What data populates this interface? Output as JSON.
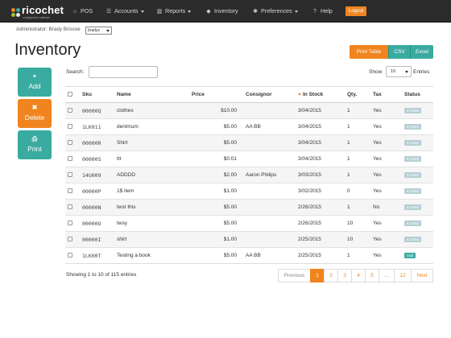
{
  "brand": {
    "name": "ricochet",
    "tagline": "consignment software"
  },
  "nav": {
    "items": [
      {
        "icon": "home-icon",
        "glyph": "⌂",
        "label": "POS"
      },
      {
        "icon": "users-icon",
        "glyph": "☰",
        "label": "Accounts"
      },
      {
        "icon": "bar-chart-icon",
        "glyph": "▥",
        "label": "Reports"
      },
      {
        "icon": "tag-icon",
        "glyph": "◆",
        "label": "Inventory"
      },
      {
        "icon": "gear-icon",
        "glyph": "✱",
        "label": "Preferences"
      },
      {
        "icon": "question-icon",
        "glyph": "?",
        "label": "Help"
      }
    ],
    "logout": "Logout"
  },
  "admin": {
    "label": "Administrator: Brady Briscoe",
    "user_select": "bradys"
  },
  "page": {
    "title": "Inventory"
  },
  "export": {
    "print_table": "Print Table",
    "csv": "CSV",
    "excel": "Excel"
  },
  "actions": {
    "add": {
      "glyph": "+",
      "label": "Add"
    },
    "delete": {
      "glyph": "✖",
      "label": "Delete"
    },
    "print": {
      "glyph": "⎙",
      "label": "Print"
    }
  },
  "table": {
    "search_label": "Search:",
    "search_value": "",
    "show_label": "Show",
    "page_length": "10",
    "entries_label": "Entries",
    "columns": [
      "Sku",
      "Name",
      "Price",
      "Consignor",
      "In Stock",
      "Qty.",
      "Tax",
      "Status"
    ],
    "rows": [
      {
        "sku": "00000Q",
        "name": "clothes",
        "price": "$10.00",
        "consignor": "",
        "in_stock": "3/04/2015",
        "qty": "1",
        "tax": "Yes",
        "status": "In Stock"
      },
      {
        "sku": "1LK011",
        "name": "denimum",
        "price": "$5.00",
        "consignor": "AA BB",
        "in_stock": "3/04/2015",
        "qty": "1",
        "tax": "Yes",
        "status": "In Stock"
      },
      {
        "sku": "00000R",
        "name": "Shirt",
        "price": "$5.00",
        "consignor": "",
        "in_stock": "3/04/2015",
        "qty": "1",
        "tax": "Yes",
        "status": "In Stock"
      },
      {
        "sku": "00000S",
        "name": "ttt",
        "price": "$0.01",
        "consignor": "",
        "in_stock": "3/04/2015",
        "qty": "1",
        "tax": "Yes",
        "status": "In Stock"
      },
      {
        "sku": "14U009",
        "name": "ADDDD",
        "price": "$2.00",
        "consignor": "Aaron Philips",
        "in_stock": "3/03/2015",
        "qty": "1",
        "tax": "Yes",
        "status": "In Stock"
      },
      {
        "sku": "00000P",
        "name": "1$ item",
        "price": "$1.00",
        "consignor": "",
        "in_stock": "3/02/2015",
        "qty": "0",
        "tax": "Yes",
        "status": "In Stock"
      },
      {
        "sku": "00000N",
        "name": "twst this",
        "price": "$5.00",
        "consignor": "",
        "in_stock": "2/26/2015",
        "qty": "1",
        "tax": "No",
        "status": "In Stock"
      },
      {
        "sku": "00000O",
        "name": "twsy",
        "price": "$5.00",
        "consignor": "",
        "in_stock": "2/26/2015",
        "qty": "10",
        "tax": "Yes",
        "status": "In Stock"
      },
      {
        "sku": "00000I",
        "name": "shirt",
        "price": "$1.00",
        "consignor": "",
        "in_stock": "2/25/2015",
        "qty": "10",
        "tax": "Yes",
        "status": "In Stock"
      },
      {
        "sku": "1LK00T",
        "name": "Testing a book",
        "price": "$5.00",
        "consignor": "AA BB",
        "in_stock": "2/25/2015",
        "qty": "1",
        "tax": "Yes",
        "status": "Sold"
      }
    ],
    "info": "Showing 1 to 10 of 115 entries"
  },
  "pagination": {
    "previous": "Previous",
    "pages": [
      "1",
      "2",
      "3",
      "4",
      "5",
      "…",
      "12"
    ],
    "next": "Next",
    "current": "1"
  },
  "colors": {
    "navbar": "#2b2b2b",
    "accent_orange": "#f0851f",
    "accent_teal": "#3aaba0"
  }
}
